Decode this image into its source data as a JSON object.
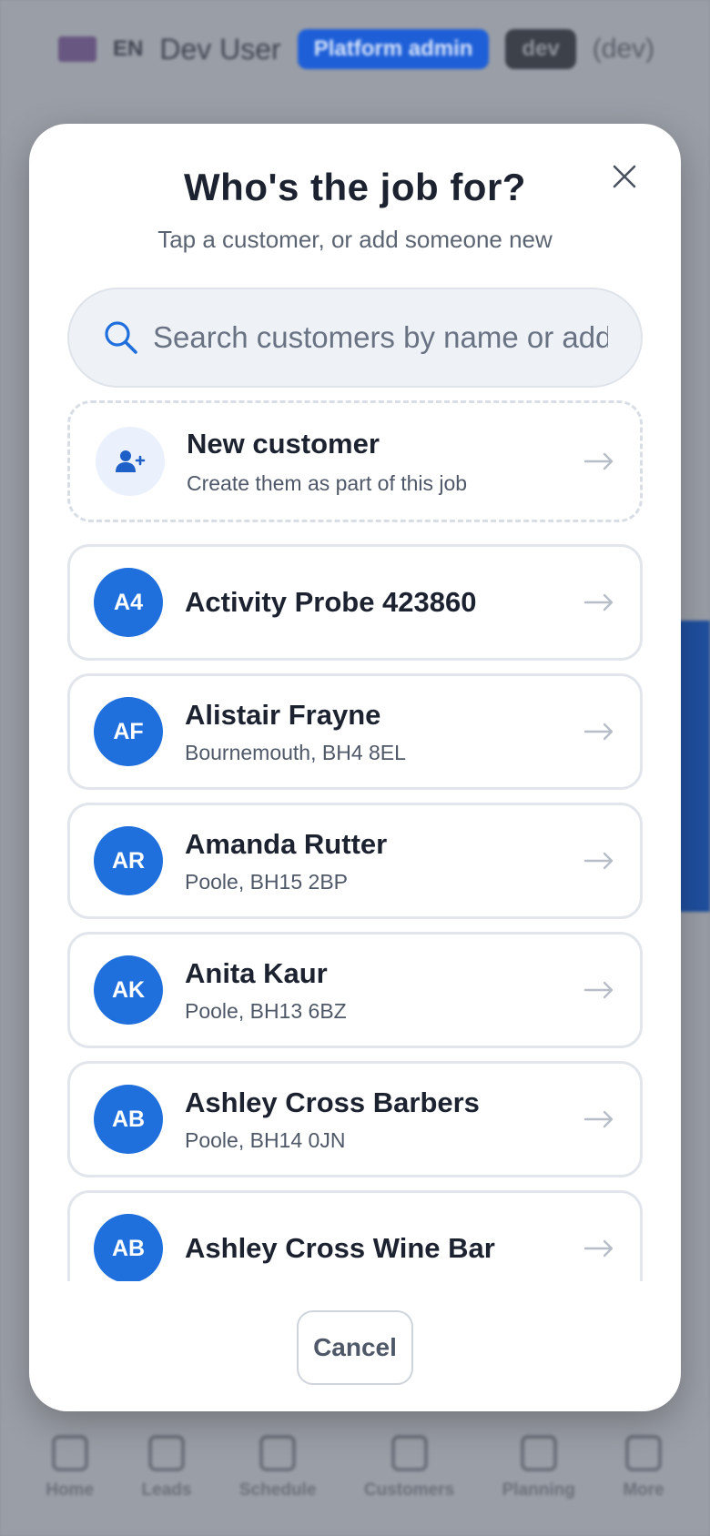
{
  "background": {
    "header": {
      "language": "EN",
      "user": "Dev User",
      "role_badge": "Platform admin",
      "env_badge": "dev",
      "env_label": "(dev)"
    },
    "nav": [
      {
        "label": "Home",
        "icon": "home-icon"
      },
      {
        "label": "Leads",
        "icon": "funnel-icon"
      },
      {
        "label": "Schedule",
        "icon": "calendar-icon"
      },
      {
        "label": "Customers",
        "icon": "users-icon"
      },
      {
        "label": "Planning",
        "icon": "clipboard-icon"
      },
      {
        "label": "More",
        "icon": "grid-icon"
      }
    ]
  },
  "modal": {
    "title": "Who's the job for?",
    "subtitle": "Tap a customer, or add someone new",
    "search": {
      "placeholder": "Search customers by name or address",
      "value": ""
    },
    "new_customer": {
      "title": "New customer",
      "subtitle": "Create them as part of this job"
    },
    "customers": [
      {
        "initials": "A4",
        "name": "Activity Probe 423860",
        "address": ""
      },
      {
        "initials": "AF",
        "name": "Alistair Frayne",
        "address": "Bournemouth, BH4 8EL"
      },
      {
        "initials": "AR",
        "name": "Amanda Rutter",
        "address": "Poole, BH15 2BP"
      },
      {
        "initials": "AK",
        "name": "Anita Kaur",
        "address": "Poole, BH13 6BZ"
      },
      {
        "initials": "AB",
        "name": "Ashley Cross Barbers",
        "address": "Poole, BH14 0JN"
      },
      {
        "initials": "AB",
        "name": "Ashley Cross Wine Bar",
        "address": ""
      }
    ],
    "cancel_label": "Cancel"
  },
  "colors": {
    "accent": "#1f6fdd",
    "text": "#1c2230",
    "muted": "#5b6473"
  }
}
